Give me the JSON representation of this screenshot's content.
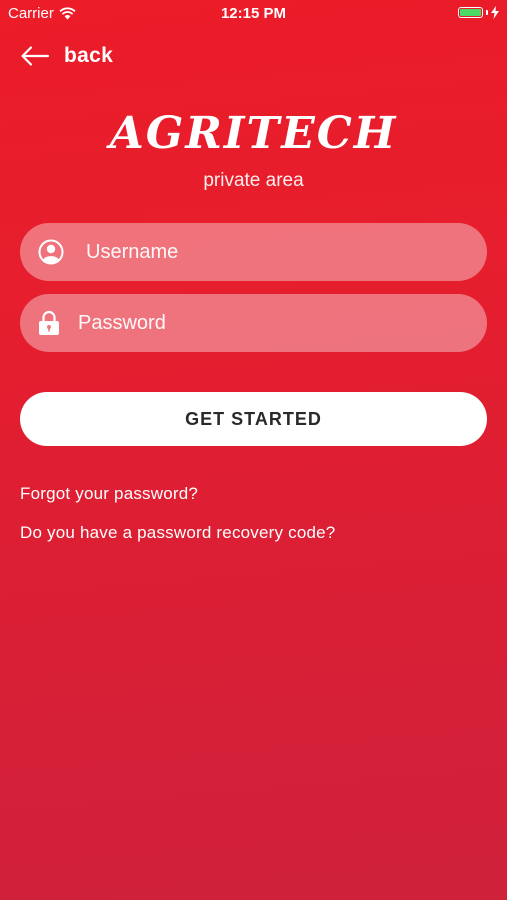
{
  "status_bar": {
    "carrier": "Carrier",
    "time": "12:15 PM"
  },
  "nav": {
    "back_label": "back"
  },
  "brand": {
    "logo": "AGRITECH",
    "subtitle": "private area"
  },
  "form": {
    "username_placeholder": "Username",
    "password_placeholder": "Password",
    "submit_label": "GET STARTED"
  },
  "links": {
    "forgot": "Forgot your password?",
    "recovery": "Do you have a password recovery code?"
  },
  "colors": {
    "background": "#e51e2e",
    "battery": "#4cd964",
    "button_text": "#2a2a2a"
  },
  "icons": [
    "wifi-icon",
    "battery-icon",
    "charging-bolt-icon",
    "back-arrow-icon",
    "user-icon",
    "lock-icon"
  ]
}
